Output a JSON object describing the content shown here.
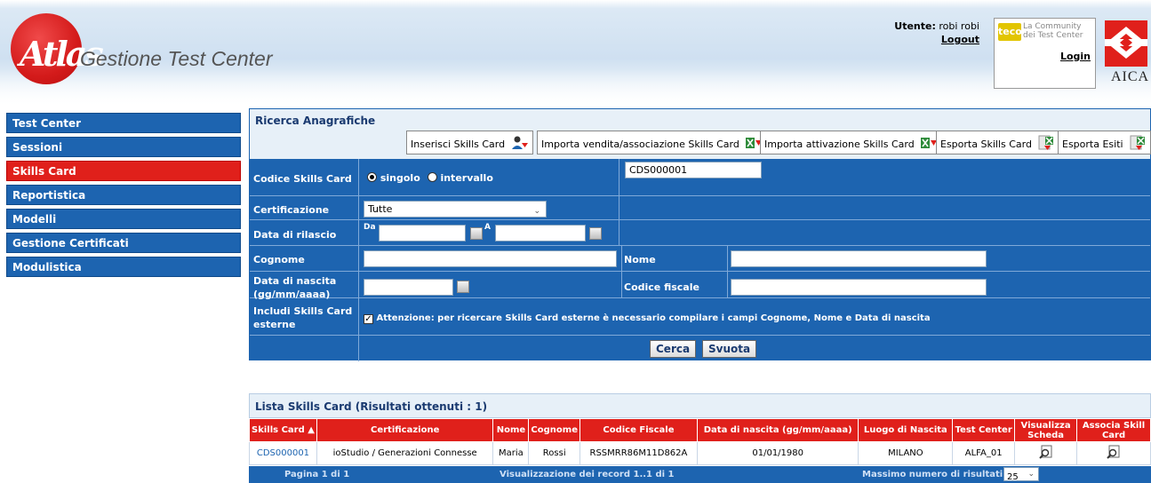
{
  "header": {
    "app_title": "Gestione Test Center",
    "logo_text": "Atlas",
    "user_label": "Utente:",
    "user_name": "robi robi",
    "logout": "Logout",
    "teco_badge": "teco",
    "teco_line1": "La Community",
    "teco_line2": "dei Test Center",
    "login": "Login",
    "aica": "AICA"
  },
  "sidebar": {
    "items": [
      {
        "label": "Test Center"
      },
      {
        "label": "Sessioni"
      },
      {
        "label": "Skills Card"
      },
      {
        "label": "Reportistica"
      },
      {
        "label": "Modelli"
      },
      {
        "label": "Gestione Certificati"
      },
      {
        "label": "Modulistica"
      }
    ],
    "active": "Skills Card"
  },
  "search": {
    "title": "Ricerca Anagrafiche",
    "toolbar": [
      {
        "label": "Inserisci Skills Card"
      },
      {
        "label": "Importa vendita/associazione Skills Card"
      },
      {
        "label": "Importa attivazione Skills Card"
      },
      {
        "label": "Esporta Skills Card"
      },
      {
        "label": "Esporta Esiti"
      }
    ],
    "codice_label": "Codice Skills Card",
    "radio_singolo": "singolo",
    "radio_intervallo": "intervallo",
    "codice_value": "CDS000001",
    "certificazione_label": "Certificazione",
    "certificazione_value": "Tutte",
    "data_rilascio_label": "Data di rilascio",
    "da_label": "Da",
    "a_label": "A",
    "cognome_label": "Cognome",
    "nome_label": "Nome",
    "nascita_label_1": "Data di nascita",
    "nascita_label_2": "(gg/mm/aaaa)",
    "cf_label": "Codice fiscale",
    "esterne_label_1": "Includi Skills Card",
    "esterne_label_2": "esterne",
    "esterne_note": "Attenzione: per ricercare Skills Card esterne è necessario compilare i campi Cognome, Nome e Data di nascita",
    "cerca": "Cerca",
    "svuota": "Svuota"
  },
  "results": {
    "title": "Lista Skills Card (Risultati ottenuti : 1)",
    "columns": [
      "Skills Card ▲",
      "Certificazione",
      "Nome",
      "Cognome",
      "Codice Fiscale",
      "Data di nascita (gg/mm/aaaa)",
      "Luogo di Nascita",
      "Test Center",
      "Visualizza Scheda",
      "Associa Skill Card"
    ],
    "rows": [
      {
        "skills_card": "CDS000001",
        "certificazione": "ioStudio / Generazioni Connesse",
        "nome": "Maria",
        "cognome": "Rossi",
        "codice_fiscale": "RSSMRR86M11D862A",
        "data_nascita": "01/01/1980",
        "luogo": "MILANO",
        "test_center": "ALFA_01"
      }
    ],
    "footer_page": "Pagina 1 di 1",
    "footer_records": "Visualizzazione dei record 1..1 di 1",
    "footer_max_label": "Massimo numero di risultati:",
    "footer_max_value": "25"
  },
  "colors": {
    "primary_blue": "#1d64b0",
    "accent_red": "#e0201b"
  }
}
